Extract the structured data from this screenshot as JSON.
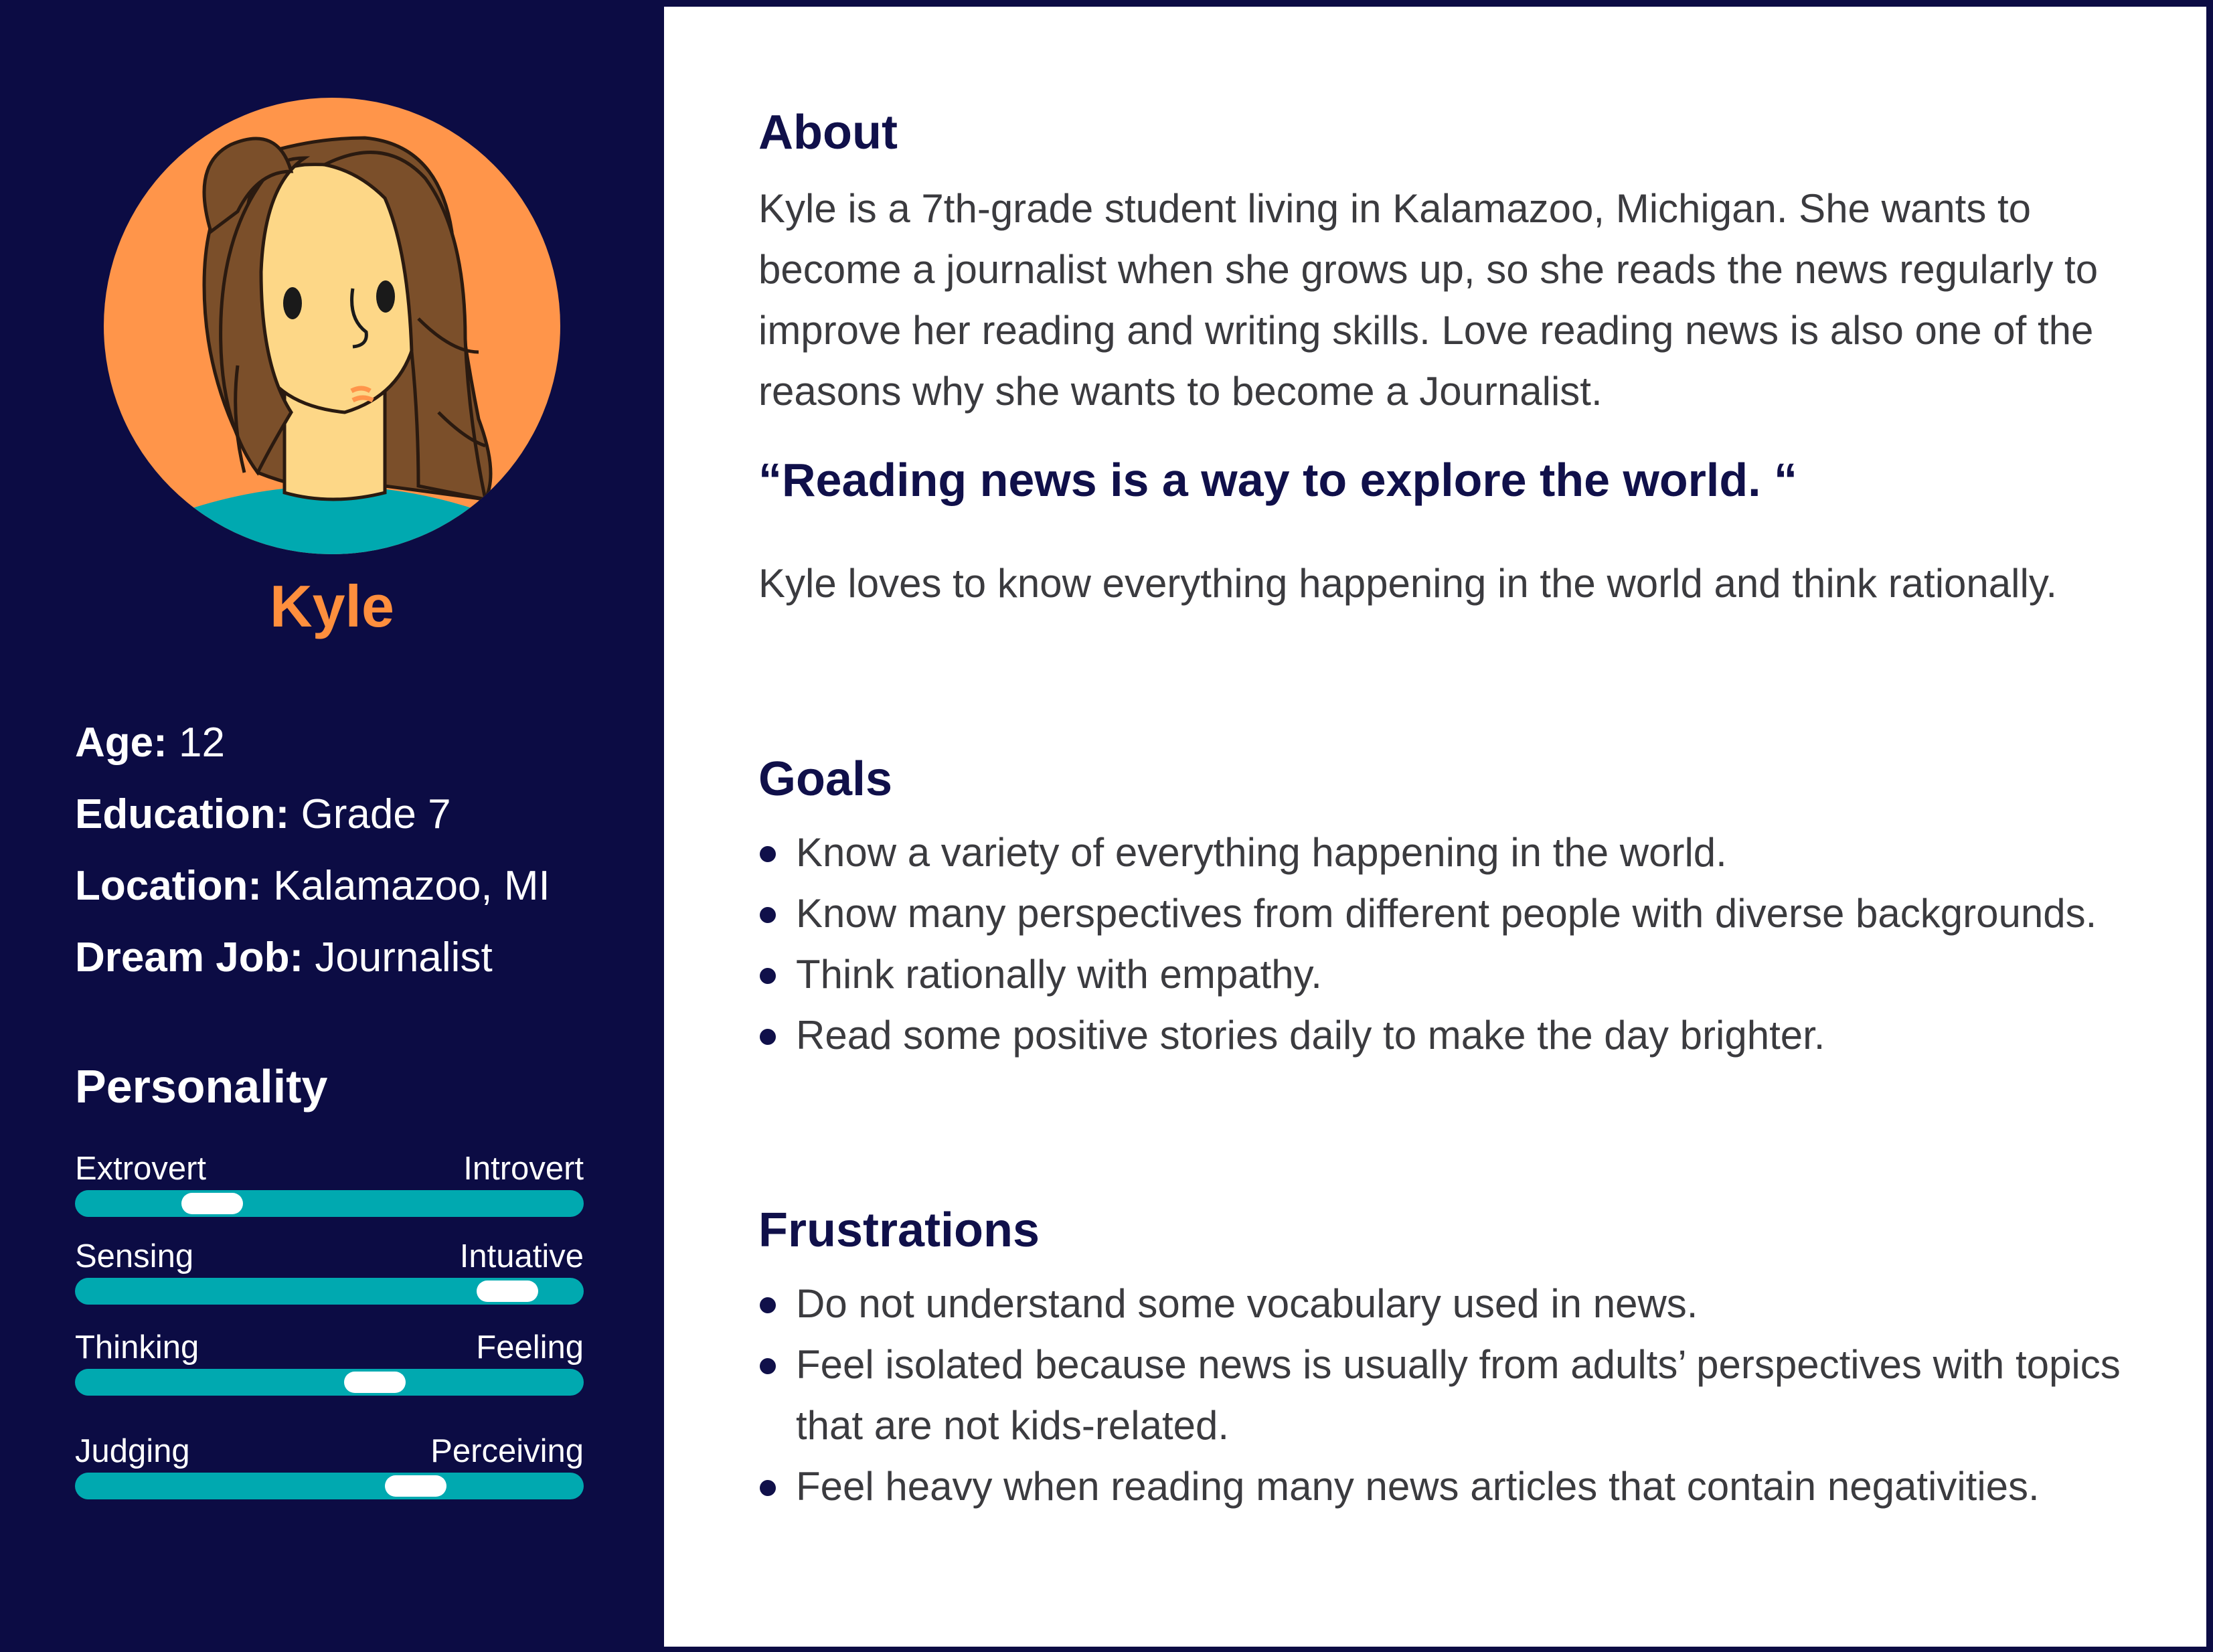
{
  "persona": {
    "name": "Kyle",
    "facts": [
      {
        "label": "Age:",
        "value": "12"
      },
      {
        "label": "Education:",
        "value": "Grade 7"
      },
      {
        "label": "Location:",
        "value": "Kalamazoo, MI"
      },
      {
        "label": "Dream Job:",
        "value": "Journalist"
      }
    ]
  },
  "personality": {
    "title": "Personality",
    "traits": [
      {
        "left": "Extrovert",
        "right": "Introvert",
        "level": 0.27
      },
      {
        "left": "Sensing",
        "right": "Intuative",
        "level": 0.85
      },
      {
        "left": "Thinking",
        "right": "Feeling",
        "level": 0.59
      },
      {
        "left": "Judging",
        "right": "Perceiving",
        "level": 0.67
      }
    ]
  },
  "about": {
    "title": "About",
    "text": "Kyle is a 7th-grade student living in Kalamazoo, Michigan. She wants to become a journalist when she grows up, so she reads the news regularly to improve her reading and writing skills. Love reading news is also one of the reasons why she wants to become a Journalist.",
    "quote": "“Reading news is a way to explore the world. “",
    "text2": "Kyle loves to know everything happening in the world and think rationally."
  },
  "goals": {
    "title": "Goals",
    "items": [
      "Know a variety of everything happening in the world.",
      "Know many perspectives from different people with diverse backgrounds.",
      "Think rationally with empathy.",
      "Read some positive stories daily to make the day brighter."
    ]
  },
  "frustrations": {
    "title": "Frustrations",
    "items": [
      "Do not understand some vocabulary used in news.",
      "Feel isolated because news is usually from adults’ perspectives with topics that are not kids-related.",
      "Feel heavy when reading many news articles that contain negativities."
    ]
  },
  "colors": {
    "sidebar": "#0c0c44",
    "accent": "#ff8f3d",
    "track": "#00a9b0",
    "heading": "#10104a"
  },
  "icons": {
    "avatar": "girl-portrait-illustration"
  }
}
